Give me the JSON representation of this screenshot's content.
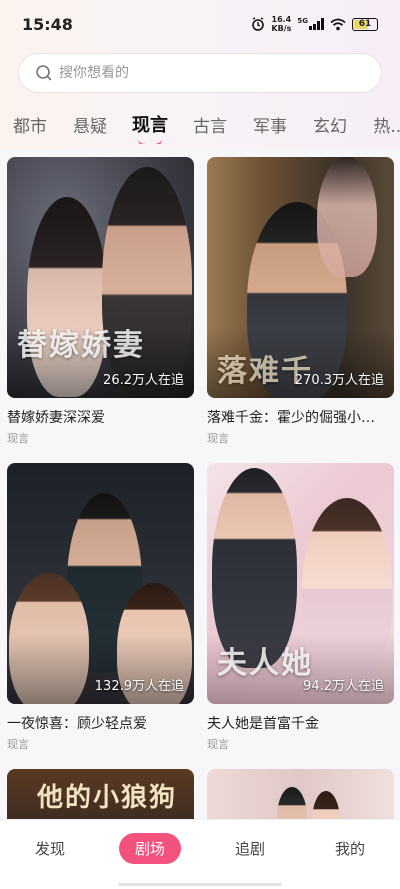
{
  "status_bar": {
    "time": "15:48",
    "net_speed_value": "16.4",
    "net_speed_unit": "KB/s",
    "network_type": "5G",
    "battery": "61"
  },
  "search": {
    "placeholder": "搜你想看的"
  },
  "tabs": [
    "都市",
    "悬疑",
    "现言",
    "古言",
    "军事",
    "玄幻",
    "热..."
  ],
  "active_tab": "现言",
  "dramas": [
    {
      "title": "替嫁娇妻深深爱",
      "genre": "现言",
      "viewers": "26.2万人在追",
      "cover_text": "替嫁娇妻",
      "cover_bg": "#3b3a44"
    },
    {
      "title": "落难千金：霍少的倔强小…",
      "genre": "现言",
      "viewers": "270.3万人在追",
      "cover_text": "落难千",
      "cover_bg": "#7a5a3a"
    },
    {
      "title": "一夜惊喜：顾少轻点爱",
      "genre": "现言",
      "viewers": "132.9万人在追",
      "cover_text": "",
      "cover_bg": "#2a2c30"
    },
    {
      "title": "夫人她是首富千金",
      "genre": "现言",
      "viewers": "94.2万人在追",
      "cover_text": "夫人她",
      "cover_bg": "#e6cfd6"
    },
    {
      "title": "",
      "genre": "",
      "viewers": "",
      "cover_text": "他的小狼狗",
      "cover_bg": "#3a2a22"
    },
    {
      "title": "",
      "genre": "",
      "viewers": "",
      "cover_text": "",
      "cover_bg": "#e9d4d2"
    }
  ],
  "bottom_nav": [
    "发现",
    "剧场",
    "追剧",
    "我的"
  ],
  "active_nav": "剧场"
}
